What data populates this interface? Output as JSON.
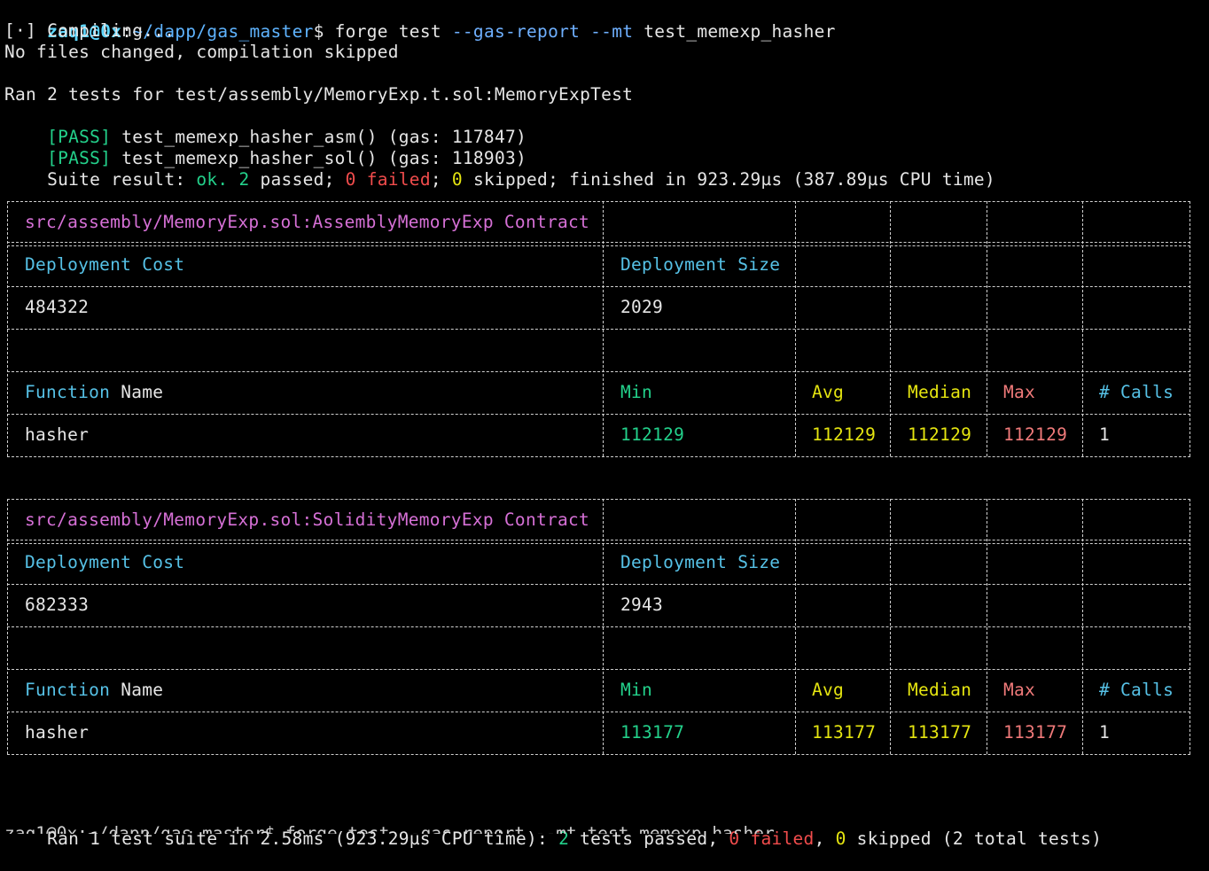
{
  "prompt": {
    "user": "zaq1@0x",
    "sep": ":",
    "path": "~/dapp/gas_master",
    "symbol": "$",
    "cmd": " forge test",
    "flags": " --gas-report --mt",
    "arg": " test_memexp_hasher"
  },
  "output": {
    "compiling": "[⋅] Compiling...",
    "nochange": "No files changed, compilation skipped",
    "ran": "Ran 2 tests for test/assembly/MemoryExp.t.sol:MemoryExpTest",
    "tests": [
      {
        "status": "[PASS]",
        "text": " test_memexp_hasher_asm() (gas: 117847)"
      },
      {
        "status": "[PASS]",
        "text": " test_memexp_hasher_sol() (gas: 118903)"
      }
    ],
    "suite": {
      "prefix": "Suite result: ",
      "ok": "ok.",
      "passed_n": " 2",
      "passed_t": " passed; ",
      "failed_n": "0",
      "failed_t": " failed",
      "semi": "; ",
      "skipped_n": "0",
      "rest": " skipped; finished in 923.29µs (387.89µs CPU time)"
    }
  },
  "labels": {
    "deploy_cost": "Deployment Cost",
    "deploy_size": "Deployment Size",
    "fn_a": "Function",
    "fn_b": " Name",
    "min": "Min",
    "avg": "Avg",
    "median": "Median",
    "max": "Max",
    "calls": "# Calls"
  },
  "tables": [
    {
      "contract": "src/assembly/MemoryExp.sol:AssemblyMemoryExp Contract",
      "deploy_cost": "484322",
      "deploy_size": "2029",
      "fn": "hasher",
      "min": "112129",
      "avg": "112129",
      "median": "112129",
      "max": "112129",
      "calls": "1"
    },
    {
      "contract": "src/assembly/MemoryExp.sol:SolidityMemoryExp Contract",
      "deploy_cost": "682333",
      "deploy_size": "2943",
      "fn": "hasher",
      "min": "113177",
      "avg": "113177",
      "median": "113177",
      "max": "113177",
      "calls": "1"
    }
  ],
  "summary": {
    "a": "Ran 1 test suite in 2.58ms (923.29µs CPU time): ",
    "passed_n": "2",
    "passed_t": " tests passed, ",
    "failed_n": "0",
    "failed_t": " failed",
    "comma": ", ",
    "skipped_n": "0",
    "rest": " skipped (2 total tests)"
  },
  "next_prompt": "zaq1@0x:~/dapp/gas_master$ forge test --gas-report --mt test_memexp_hasher"
}
